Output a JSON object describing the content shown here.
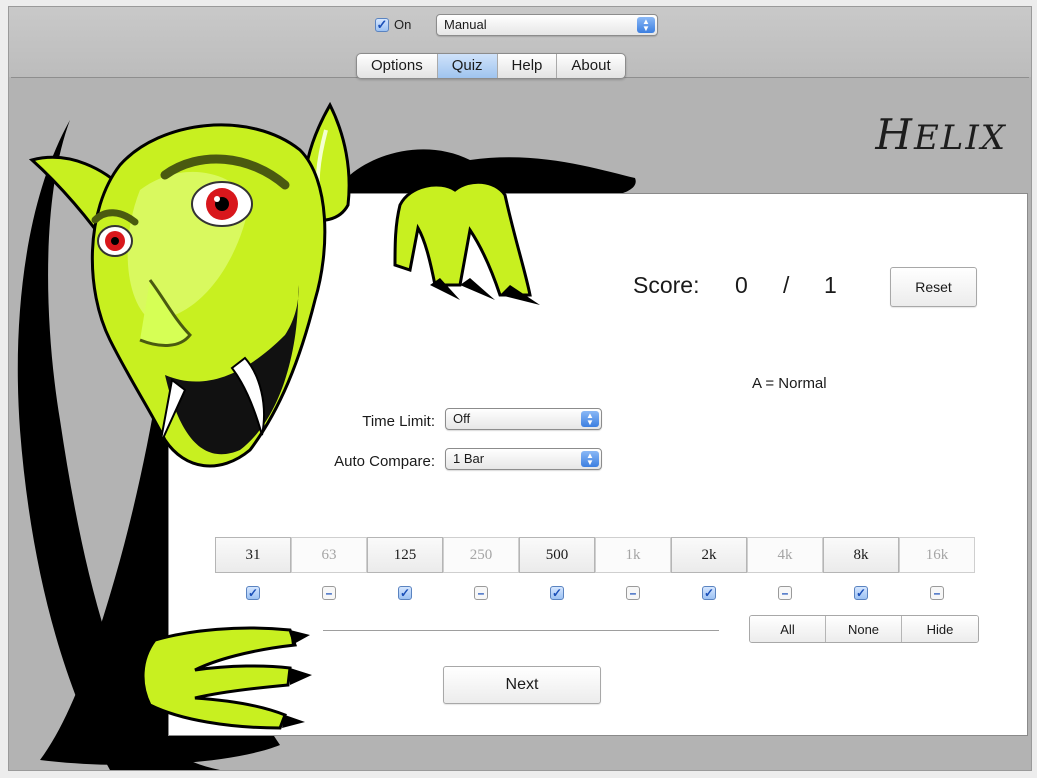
{
  "topbar": {
    "on_label": "On",
    "on_checked": true,
    "mode_select_value": "Manual"
  },
  "tabs": [
    {
      "label": "Options",
      "active": false
    },
    {
      "label": "Quiz",
      "active": true
    },
    {
      "label": "Help",
      "active": false
    },
    {
      "label": "About",
      "active": false
    }
  ],
  "logo": {
    "first": "H",
    "rest": "ELIX"
  },
  "quiz": {
    "score_label": "Score:",
    "score_correct": "0",
    "score_sep": "/",
    "score_total": "1",
    "reset_label": "Reset",
    "answer_text": "A = Normal",
    "time_limit_label": "Time Limit:",
    "time_limit_value": "Off",
    "auto_compare_label": "Auto Compare:",
    "auto_compare_value": "1 Bar",
    "bands": [
      {
        "label": "31",
        "checked": true
      },
      {
        "label": "63",
        "checked": false
      },
      {
        "label": "125",
        "checked": true
      },
      {
        "label": "250",
        "checked": false
      },
      {
        "label": "500",
        "checked": true
      },
      {
        "label": "1k",
        "checked": false
      },
      {
        "label": "2k",
        "checked": true
      },
      {
        "label": "4k",
        "checked": false
      },
      {
        "label": "8k",
        "checked": true
      },
      {
        "label": "16k",
        "checked": false
      }
    ],
    "all_label": "All",
    "none_label": "None",
    "hide_label": "Hide",
    "next_label": "Next"
  },
  "colors": {
    "window_bg": "#b3b3b3",
    "panel_bg": "#ffffff",
    "accent_blue": "#3d7fe0",
    "vampire_skin": "#c8f020",
    "cape": "#000000",
    "eye_red": "#d8171c"
  }
}
